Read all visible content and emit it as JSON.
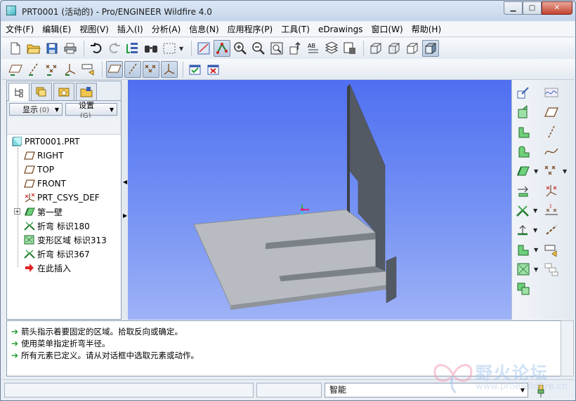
{
  "window": {
    "title": "PRT0001 (活动的) - Pro/ENGINEER Wildfire 4.0",
    "minimize_label": "▁",
    "maximize_label": "□",
    "close_label": "✕"
  },
  "menubar": {
    "items": [
      "文件(F)",
      "编辑(E)",
      "视图(V)",
      "插入(I)",
      "分析(A)",
      "信息(N)",
      "应用程序(P)",
      "工具(T)",
      "eDrawings",
      "窗口(W)",
      "帮助(H)"
    ]
  },
  "toolbar_row1": {
    "icons": [
      "new-file-icon",
      "open-folder-icon",
      "save-icon",
      "print-icon",
      "undo-icon",
      "redo-icon",
      "regenerate-icon",
      "find-icon",
      "select-box-icon",
      "view-manager-icon",
      "datum-display-icon",
      "zoom-in-icon",
      "zoom-out-icon",
      "refit-icon",
      "reorient-icon",
      "saved-views-icon",
      "layers-icon",
      "appearance-icon",
      "wireframe-icon",
      "hidden-line-icon",
      "no-hidden-icon",
      "shading-icon"
    ]
  },
  "toolbar_row2": {
    "icons": [
      "datum-plane-display-icon",
      "datum-axis-display-icon",
      "datum-point-display-icon",
      "csys-display-icon",
      "annotation-display-icon",
      "plane-tag-icon",
      "axis-tag-icon",
      "point-tag-icon",
      "csys-tag-icon",
      "confirm-icon",
      "cancel-icon"
    ]
  },
  "left_panel": {
    "tabs": [
      "model-tree-tab",
      "layer-tab",
      "favorites-tab",
      "folder-tab"
    ],
    "show_dropdown": "显示",
    "show_hint": "(0)",
    "settings_dropdown": "设置",
    "settings_hint": "(G)",
    "tree": [
      {
        "label": "PRT0001.PRT",
        "icon": "part-icon"
      },
      {
        "label": "RIGHT",
        "icon": "datum-plane-icon"
      },
      {
        "label": "TOP",
        "icon": "datum-plane-icon"
      },
      {
        "label": "FRONT",
        "icon": "datum-plane-icon"
      },
      {
        "label": "PRT_CSYS_DEF",
        "icon": "csys-icon"
      },
      {
        "label": "第一壁",
        "icon": "first-wall-icon"
      },
      {
        "label": "折弯 标识180",
        "icon": "bend-icon"
      },
      {
        "label": "变形区域 标识313",
        "icon": "deform-area-icon"
      },
      {
        "label": "折弯 标识367",
        "icon": "bend-icon"
      },
      {
        "label": "在此插入",
        "icon": "insert-here-icon"
      }
    ]
  },
  "right_toolbar": {
    "icons": [
      "sketch-icon",
      "datum-curve-icon",
      "datum-plane-tool-icon",
      "flat-wall-icon",
      "datum-axis-tool-icon",
      "extend-wall-icon",
      "datum-curve-tool-icon",
      "bend-tool-icon",
      "datum-point-tool-icon",
      "rip-icon",
      "csys-tool-icon",
      "form-icon",
      "analysis-icon",
      "flatten-icon",
      "deform-area-tool-icon",
      "unbend-icon",
      "bend-back-icon",
      "corner-relief-icon"
    ]
  },
  "messages": [
    "箭头指示着要固定的区域。拾取反向或确定。",
    "使用菜单指定折弯半径。",
    "所有元素已定义。请从对话框中选取元素或动作。"
  ],
  "status": {
    "filter_value": "智能"
  },
  "watermark": {
    "text": "野火论坛",
    "url": "www.proewildfire.cn"
  },
  "colors": {
    "viewport_top": "#4f6ff1",
    "viewport_bottom": "#9eb2f6",
    "model_face": "#b8bcc2",
    "model_wall": "#545a63",
    "message_arrow": "#1d9a2b"
  }
}
